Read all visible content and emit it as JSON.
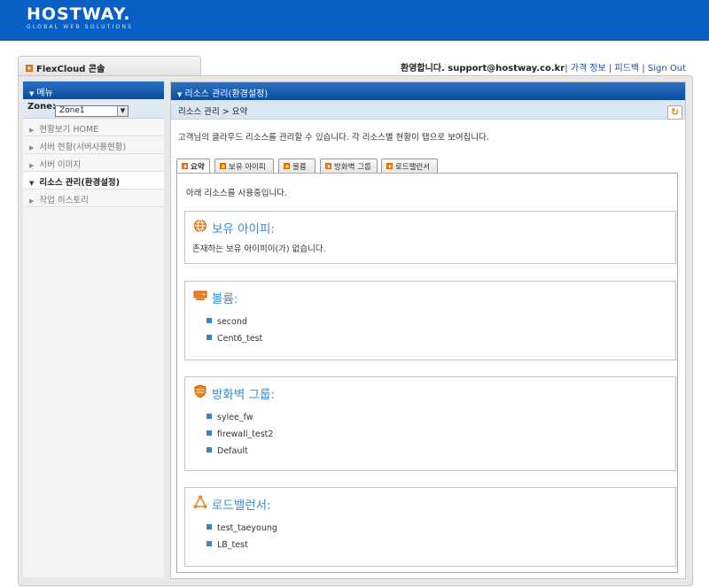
{
  "header": {
    "logo_main": "HOSTWAY.",
    "logo_sub": "GLOBAL WEB SOLUTIONS"
  },
  "console_tab": {
    "label": "FlexCloud 콘솔"
  },
  "top_links": {
    "welcome": "환영합니다. support@hostway.co.kr",
    "pricing": "가격 정보",
    "feedback": "피드백",
    "sign_out": "Sign Out"
  },
  "sidebar": {
    "title": "메뉴",
    "zone_label": "Zone:",
    "zone_value": "Zone1",
    "items": [
      {
        "label": "현황보기 HOME"
      },
      {
        "label": "서버 현황(서버사용현황)"
      },
      {
        "label": "서버 이미지"
      },
      {
        "label": "리소스 관리(환경설정)"
      },
      {
        "label": "작업 히스토리"
      }
    ]
  },
  "main": {
    "title": "리소스 관리(환경설정)",
    "breadcrumb": "리소스 관리 >  요약",
    "description": "고객님의 클라우드 리소스를 관리할 수 있습니다. 각 리소스별 현황이 탭으로 보여집니다.",
    "tabs": [
      {
        "label": "요약"
      },
      {
        "label": "보유 아이피"
      },
      {
        "label": "볼륨"
      },
      {
        "label": "방화벽 그룹"
      },
      {
        "label": "로드밸런서"
      }
    ],
    "intro": "아래 리소스를 사용중입니다.",
    "sections": {
      "ip": {
        "title": "보유 아이피:",
        "text": "존재하는 보유 아이피이(가) 없습니다."
      },
      "volume": {
        "title": "볼륨:",
        "items": [
          "second",
          "Cent6_test"
        ]
      },
      "firewall": {
        "title": "방화벽 그룹:",
        "items": [
          "sylee_fw",
          "firewall_test2",
          "Default"
        ]
      },
      "lb": {
        "title": "로드밸런서:",
        "items": [
          "test_taeyoung",
          "LB_test"
        ]
      }
    }
  },
  "colors": {
    "brand_blue": "#0a5fc4",
    "panel_head": "#0b4c9c",
    "accent_orange": "#f0801a",
    "section_title": "#3b8bd0"
  }
}
